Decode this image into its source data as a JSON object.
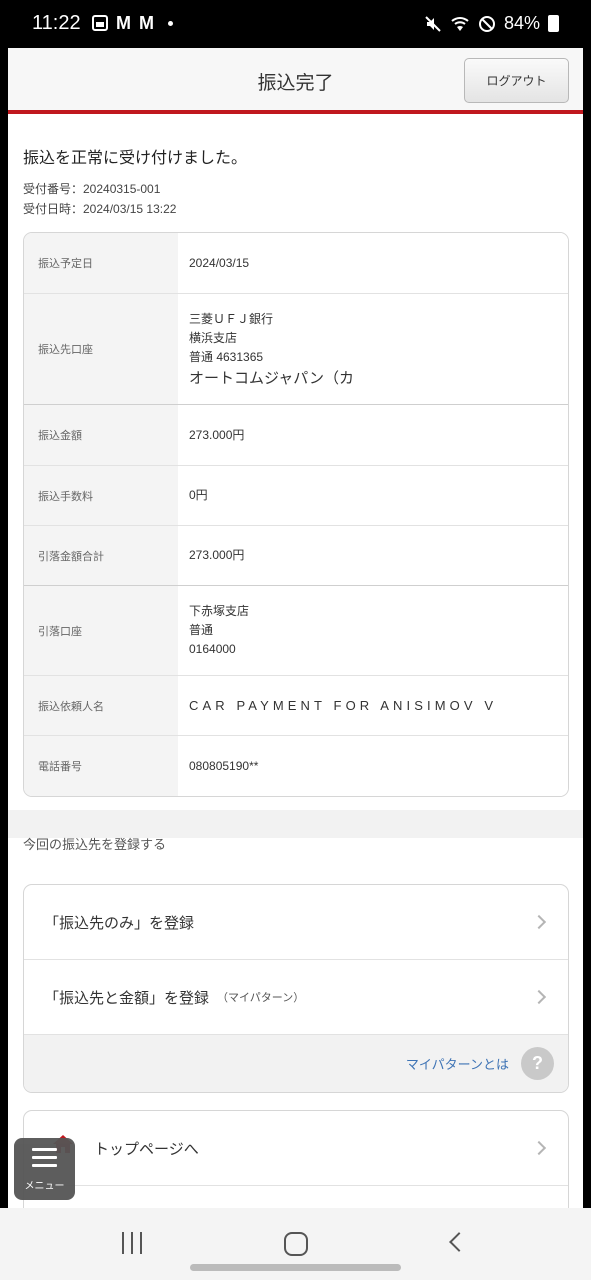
{
  "status_bar": {
    "time": "11:22",
    "icon1": "gallery-icon",
    "m1": "M",
    "m2": "M",
    "battery": "84%"
  },
  "header": {
    "title": "振込完了",
    "logout": "ログアウト"
  },
  "message": "振込を正常に受け付けました。",
  "receipt": {
    "number_line": "受付番号：20240315-001",
    "datetime_line": "受付日時：2024/03/15 13:22"
  },
  "details": {
    "scheduled_date": {
      "label": "振込予定日",
      "value": "2024/03/15"
    },
    "dest_account": {
      "label": "振込先口座",
      "bank": "三菱ＵＦＪ銀行",
      "branch": "横浜支店",
      "account": "普通 4631365",
      "name": "オートコムジャパン（カ"
    },
    "amount": {
      "label": "振込金額",
      "value": "273.000円"
    },
    "fee": {
      "label": "振込手数料",
      "value": "0円"
    },
    "total": {
      "label": "引落金額合計",
      "value": "273.000円"
    },
    "debit_account": {
      "label": "引落口座",
      "branch": "下赤塚支店",
      "type": "普通",
      "number": "0164000"
    },
    "requester": {
      "label": "振込依頼人名",
      "value": "CAR PAYMENT FOR ANISIMOV V"
    },
    "phone": {
      "label": "電話番号",
      "value": "080805190**"
    }
  },
  "register": {
    "caption": "今回の振込先を登録する",
    "dest_only": "「振込先のみ」を登録",
    "dest_amount": "「振込先と金額」を登録",
    "dest_amount_sub": "（マイパターン）",
    "mypattern_link": "マイパターンとは",
    "help": "?"
  },
  "nav": {
    "top_page": "トップページへ",
    "menu": "メニュー"
  },
  "colors": {
    "accent_red": "#c0181e",
    "link_blue": "#3f74b5"
  }
}
